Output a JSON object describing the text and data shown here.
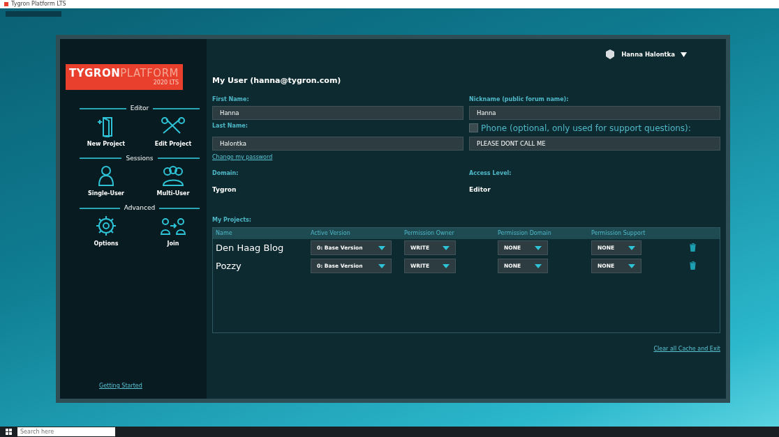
{
  "window": {
    "title": "Tygron Platform LTS"
  },
  "sidebar": {
    "logo": {
      "brand": "TYGRON",
      "product": "PLATFORM",
      "version": "2020 LTS"
    },
    "sections": [
      {
        "title": "Editor",
        "items": [
          {
            "label": "New Project"
          },
          {
            "label": "Edit Project"
          }
        ]
      },
      {
        "title": "Sessions",
        "items": [
          {
            "label": "Single-User"
          },
          {
            "label": "Multi-User"
          }
        ]
      },
      {
        "title": "Advanced",
        "items": [
          {
            "label": "Options"
          },
          {
            "label": "Join"
          }
        ]
      }
    ],
    "footer_link": "Getting Started"
  },
  "user_menu": {
    "name": "Hanna Halontka"
  },
  "form": {
    "title": "My User (hanna@tygron.com)",
    "first_name": {
      "label": "First Name:",
      "value": "Hanna"
    },
    "nickname": {
      "label": "Nickname (public forum name):",
      "value": "Hanna"
    },
    "last_name": {
      "label": "Last Name:",
      "value": "Halontka"
    },
    "phone": {
      "label": "Phone (optional, only used for support questions):",
      "checked": false,
      "value": "PLEASE DONT CALL ME"
    },
    "change_password": "Change my password",
    "domain": {
      "label": "Domain:",
      "value": "Tygron"
    },
    "access_level": {
      "label": "Access Level:",
      "value": "Editor"
    }
  },
  "projects": {
    "label": "My Projects:",
    "columns": [
      "Name",
      "Active Version",
      "Permission Owner",
      "Permission Domain",
      "Permission Support"
    ],
    "rows": [
      {
        "name": "Den Haag Blog",
        "version": "0: Base Version",
        "owner": "WRITE",
        "domain": "NONE",
        "support": "NONE"
      },
      {
        "name": "Pozzy",
        "version": "0: Base Version",
        "owner": "WRITE",
        "domain": "NONE",
        "support": "NONE"
      }
    ]
  },
  "footer_link": "Clear all Cache and Exit",
  "taskbar": {
    "search": {
      "placeholder": "Search here"
    }
  }
}
